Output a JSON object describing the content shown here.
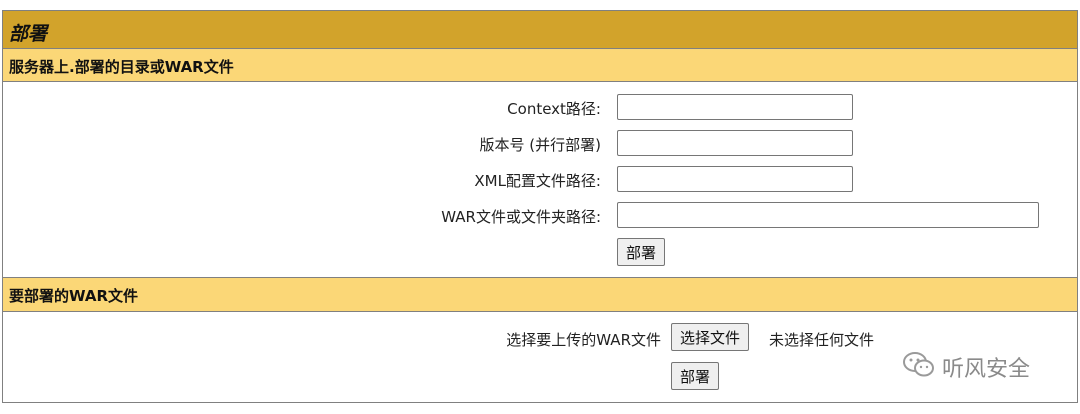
{
  "panel": {
    "title": "部署",
    "section_dir": {
      "header": "服务器上.部署的目录或WAR文件",
      "fields": [
        {
          "label": "Context路径:",
          "value": ""
        },
        {
          "label": "版本号 (并行部署)",
          "value": ""
        },
        {
          "label": "XML配置文件路径:",
          "value": ""
        },
        {
          "label": "WAR文件或文件夹路径:",
          "value": ""
        }
      ],
      "deploy_label": "部署"
    },
    "section_upload": {
      "header": "要部署的WAR文件",
      "upload_label": "选择要上传的WAR文件",
      "choose_file_label": "选择文件",
      "no_file_text": "未选择任何文件",
      "deploy_label": "部署"
    }
  },
  "watermark": {
    "text": "听风安全",
    "icon": "wechat-icon"
  },
  "colors": {
    "title_bar": "#d2a32b",
    "section_header": "#fbd777",
    "border": "#808080"
  }
}
